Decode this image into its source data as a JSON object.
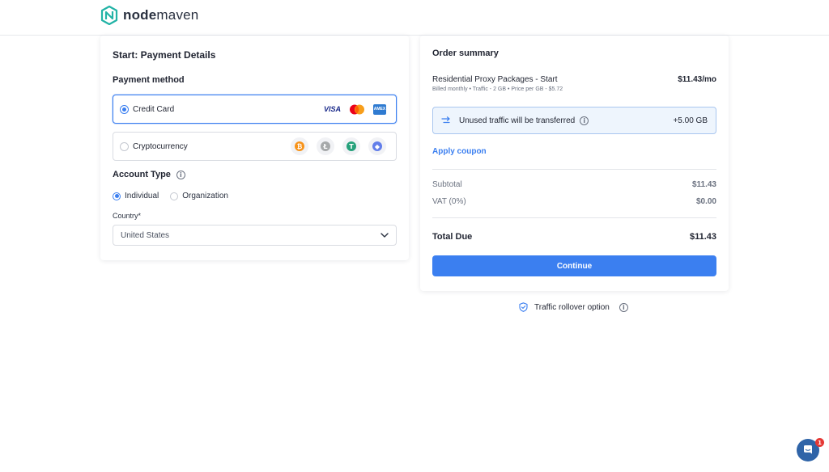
{
  "brand": {
    "name_bold": "node",
    "name_rest": "maven",
    "color": "#22b3a6"
  },
  "payment": {
    "title": "Start: Payment Details",
    "method_heading": "Payment method",
    "methods": [
      {
        "label": "Credit Card",
        "selected": true,
        "icons": [
          "visa-icon",
          "mastercard-icon",
          "amex-icon"
        ]
      },
      {
        "label": "Cryptocurrency",
        "selected": false,
        "icons": [
          "bitcoin-icon",
          "litecoin-icon",
          "tether-icon",
          "ethereum-icon"
        ]
      }
    ],
    "card_brands": {
      "visa": "VISA",
      "amex": "AMEX"
    },
    "account_type_heading": "Account Type",
    "account_types": [
      {
        "label": "Individual",
        "selected": true
      },
      {
        "label": "Organization",
        "selected": false
      }
    ],
    "country_label": "Country*",
    "country_value": "United States"
  },
  "summary": {
    "title": "Order summary",
    "product_name": "Residential Proxy Packages - Start",
    "product_meta": "Billed monthly • Traffic - 2 GB • Price per GB - $5.72",
    "product_price": "$11.43/mo",
    "transfer_text": "Unused traffic will be transferred",
    "transfer_amount": "+5.00 GB",
    "coupon_label": "Apply coupon",
    "subtotal_label": "Subtotal",
    "subtotal_value": "$11.43",
    "vat_label": "VAT (0%)",
    "vat_value": "$0.00",
    "total_label": "Total Due",
    "total_value": "$11.43",
    "continue_label": "Continue"
  },
  "rollover": {
    "label": "Traffic rollover option"
  },
  "chat": {
    "badge_count": "1"
  },
  "colors": {
    "accent": "#3b7ff0",
    "transfer_bg": "#eef5fd",
    "chat": "#2f64a8",
    "badge": "#e53935"
  }
}
